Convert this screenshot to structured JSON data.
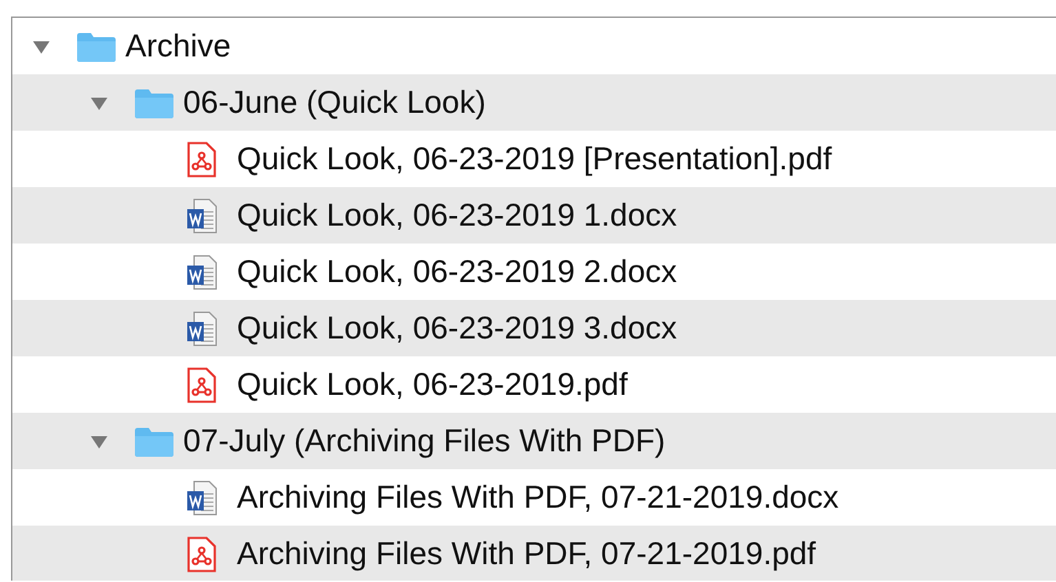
{
  "tree": [
    {
      "kind": "folder",
      "name": "Archive",
      "expanded": true,
      "children": [
        {
          "kind": "folder",
          "name": "06-June (Quick Look)",
          "expanded": true,
          "children": [
            {
              "kind": "pdf",
              "name": "Quick Look, 06-23-2019 [Presentation].pdf"
            },
            {
              "kind": "docx",
              "name": "Quick Look, 06-23-2019 1.docx"
            },
            {
              "kind": "docx",
              "name": "Quick Look, 06-23-2019 2.docx"
            },
            {
              "kind": "docx",
              "name": "Quick Look, 06-23-2019 3.docx"
            },
            {
              "kind": "pdf",
              "name": "Quick Look, 06-23-2019.pdf"
            }
          ]
        },
        {
          "kind": "folder",
          "name": "07-July (Archiving Files With PDF)",
          "expanded": true,
          "children": [
            {
              "kind": "docx",
              "name": "Archiving Files With PDF, 07-21-2019.docx"
            },
            {
              "kind": "pdf",
              "name": "Archiving Files With PDF, 07-21-2019.pdf"
            }
          ]
        }
      ]
    }
  ]
}
